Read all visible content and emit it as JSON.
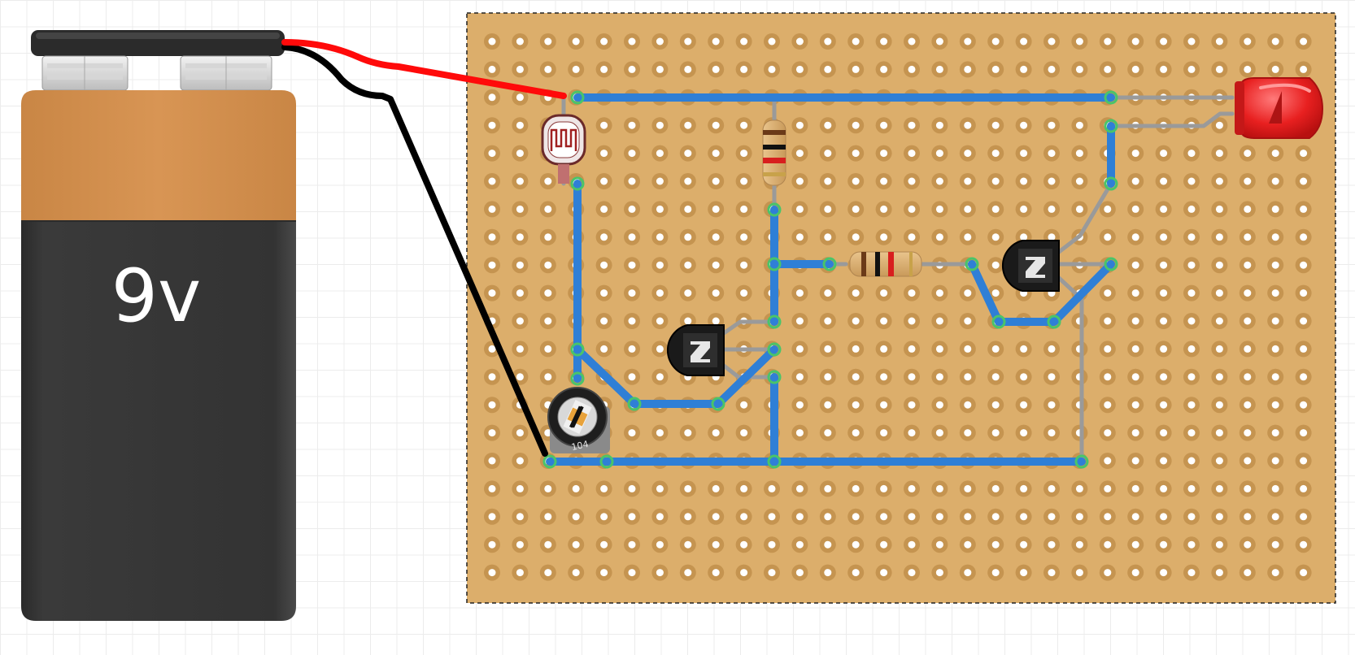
{
  "battery": {
    "label": "9v"
  },
  "potentiometer": {
    "marking": "104"
  },
  "colors": {
    "board": "#dcae6b",
    "hole_ring": "#c59450",
    "trace": "#2f7fd6",
    "trace_edge": "#1f5fb0",
    "jumper": "#9a9a9a",
    "wire_positive": "#ff0a0a",
    "wire_negative": "#000000",
    "led": "#e82020"
  },
  "components": [
    "battery-9v",
    "battery-clip",
    "stripboard",
    "light-dependent-resistor",
    "resistor-vertical",
    "resistor-horizontal",
    "npn-transistor-left",
    "npn-transistor-right",
    "trimmer-potentiometer",
    "red-led"
  ]
}
